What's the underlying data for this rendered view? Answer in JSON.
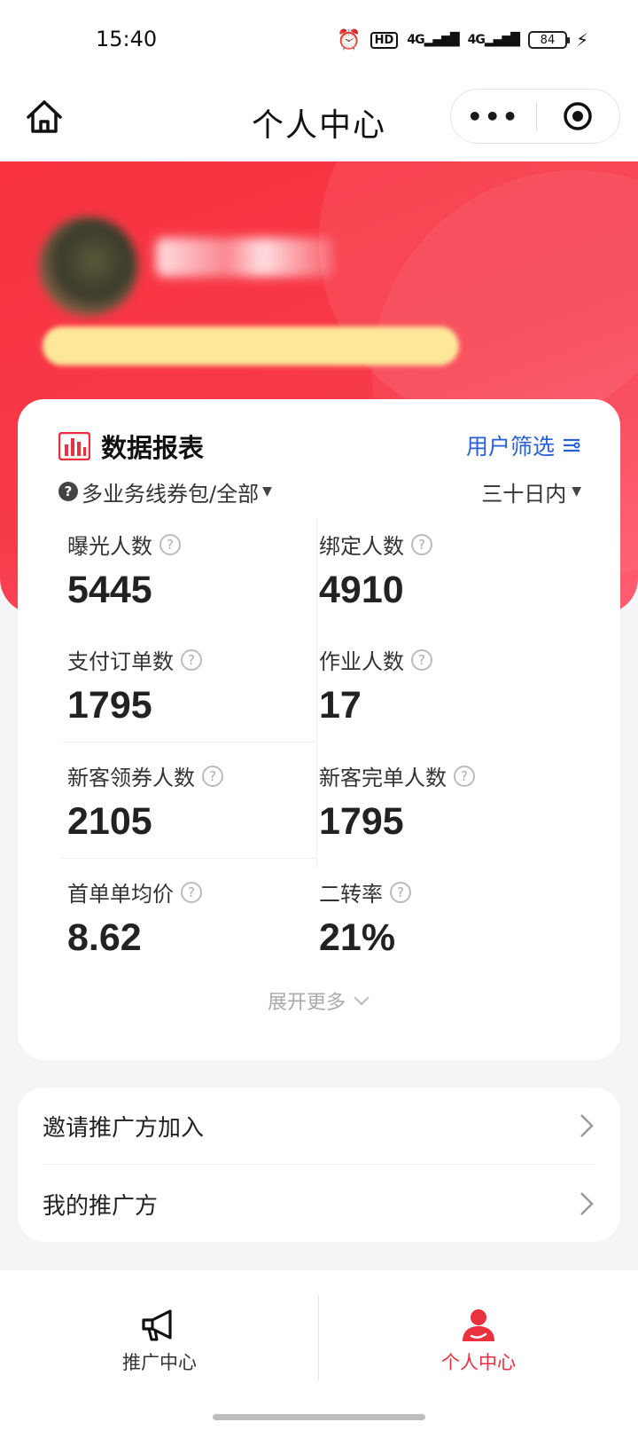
{
  "status_bar": {
    "time": "15:40",
    "network_1": "4G",
    "network_2": "4G",
    "battery": "84"
  },
  "nav": {
    "title": "个人中心",
    "more_label": "•••"
  },
  "profile": {
    "name": "",
    "tag": ""
  },
  "report": {
    "title": "数据报表",
    "filter_label": "用户筛选",
    "business_line": "多业务线券包/全部",
    "time_range": "三十日内",
    "expand_label": "展开更多",
    "metrics": [
      {
        "label": "曝光人数",
        "value": "5445"
      },
      {
        "label": "绑定人数",
        "value": "4910"
      },
      {
        "label": "支付订单数",
        "value": "1795"
      },
      {
        "label": "作业人数",
        "value": "17"
      },
      {
        "label": "新客领券人数",
        "value": "2105"
      },
      {
        "label": "新客完单人数",
        "value": "1795"
      },
      {
        "label": "首单单均价",
        "value": "8.62"
      },
      {
        "label": "二转率",
        "value": "21%"
      }
    ]
  },
  "menu": {
    "items": [
      {
        "label": "邀请推广方加入"
      },
      {
        "label": "我的推广方"
      }
    ]
  },
  "tabs": [
    {
      "label": "推广中心",
      "icon": "megaphone-icon"
    },
    {
      "label": "个人中心",
      "icon": "person-icon"
    }
  ],
  "colors": {
    "brand_red": "#f8323f",
    "link_blue": "#2b5fd9",
    "active_tab": "#e9323e"
  }
}
